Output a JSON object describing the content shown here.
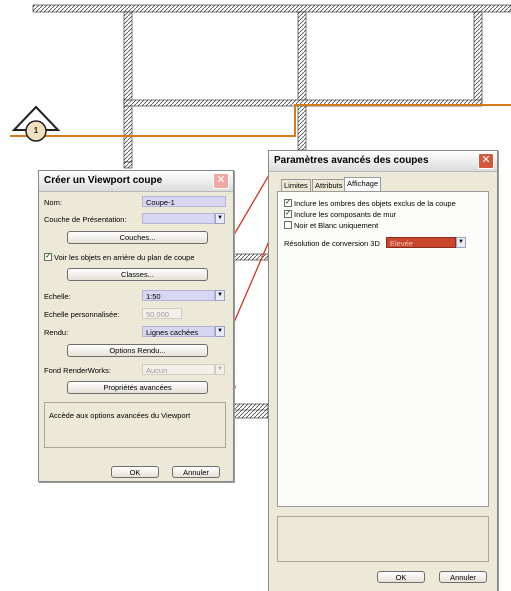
{
  "canvas": {
    "marker_number": "1"
  },
  "viewport_dialog": {
    "title": "Créer un Viewport coupe",
    "name_label": "Nom:",
    "name_value": "Coupe-1",
    "layer_label": "Couche de Présentation:",
    "layer_value": "",
    "layers_button": "Couches...",
    "show_behind_label": "Voir les objets en arrière du plan de coupe",
    "show_behind_checked": true,
    "classes_button": "Classes...",
    "scale_label": "Echelle:",
    "scale_value": "1:50",
    "custom_scale_label": "Echelle personnalisée:",
    "custom_scale_value": "50.000",
    "render_label": "Rendu:",
    "render_value": "Lignes cachées",
    "render_options_button": "Options Rendu...",
    "renderworks_bg_label": "Fond RenderWorks:",
    "renderworks_bg_value": "Aucun",
    "advanced_button": "Propriétés avancées",
    "help_text": "Accède aux options avancées du Viewport",
    "ok_button": "OK",
    "cancel_button": "Annuler"
  },
  "advanced_dialog": {
    "title": "Paramètres avancés des coupes",
    "tabs": [
      {
        "label": "Limites",
        "active": false
      },
      {
        "label": "Attributs",
        "active": false
      },
      {
        "label": "Affichage",
        "active": true
      }
    ],
    "checkboxes": [
      {
        "label": "Inclure les ombres des objets exclus de la coupe",
        "checked": true
      },
      {
        "label": "Inclure les composants de mur",
        "checked": true
      },
      {
        "label": "Noir et Blanc uniquement",
        "checked": false
      }
    ],
    "resolution_label": "Résolution de conversion 3D",
    "resolution_value": "Elevée",
    "ok_button": "OK",
    "cancel_button": "Annuler"
  },
  "colors": {
    "annotation_red": "#e0301e",
    "section_line_orange": "#d77a1a",
    "field_lavender": "#d8d6f0",
    "resolution_field": "#c8462e",
    "close_button_red": "#d4583c"
  }
}
